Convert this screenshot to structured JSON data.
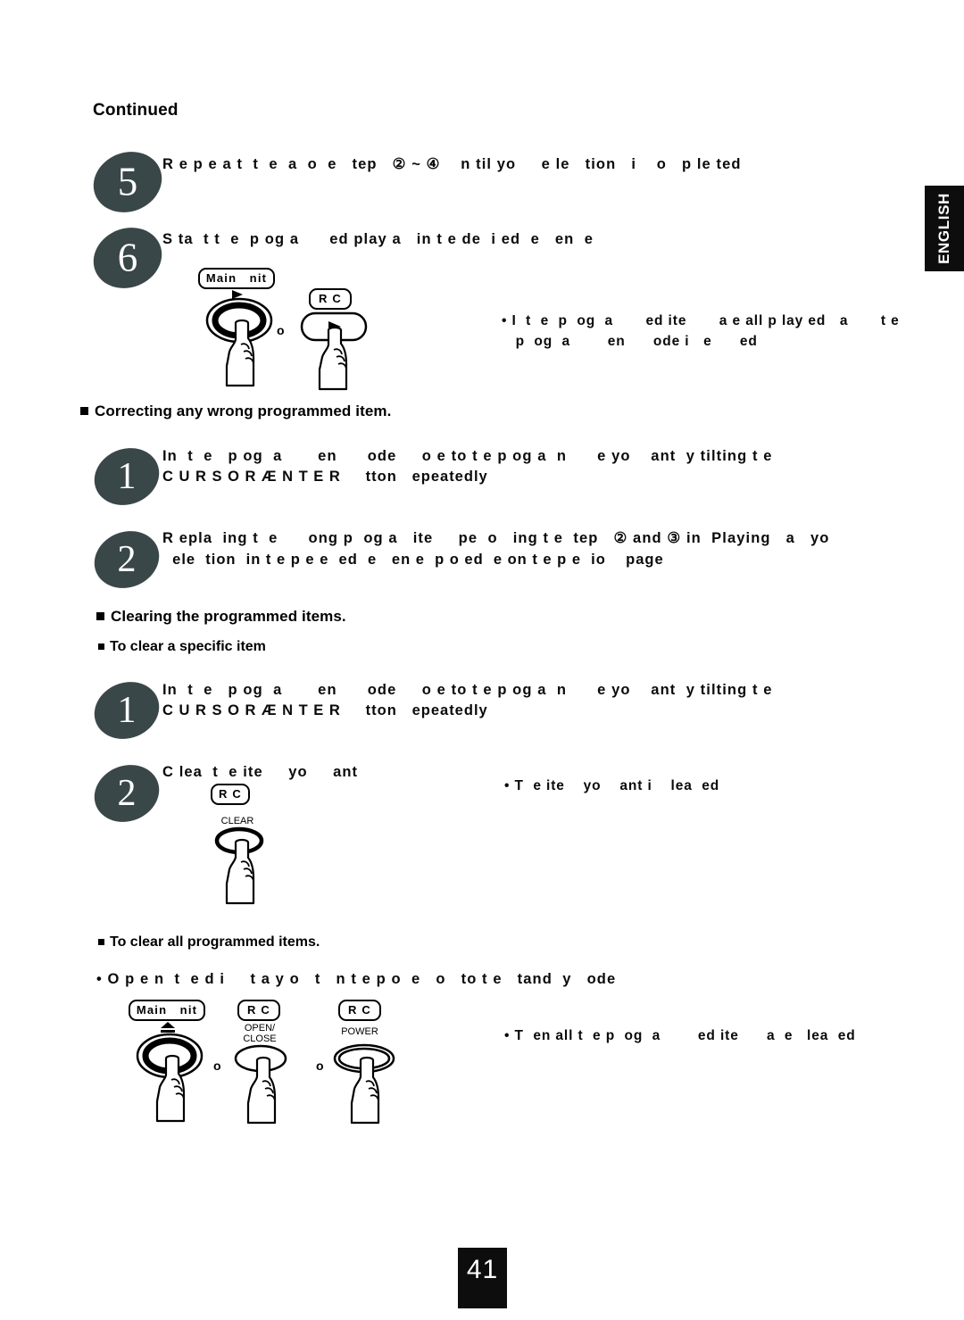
{
  "document": {
    "continued_label": "Continued",
    "side_tab_label": "ENGLISH",
    "page_number": "41"
  },
  "steps_top": [
    {
      "number": "5",
      "line1": "R e p e a t  t  e  a  o  e   tep   ② ~ ④    n til yo     e le   tion   i    o   p le ted"
    },
    {
      "number": "6",
      "line1": "S ta  t t  e  p og a      ed play a   in t e de  i ed  e   en  e"
    }
  ],
  "note_top": {
    "line1": "• I  t  e  p  og  a       ed ite       a e all p lay ed   a       t e",
    "line2": "   p  og  a        en      ode i   e      ed"
  },
  "device_top": {
    "main_unit_badge": "Main   nit",
    "rc_badge": "R C",
    "or_label": "o",
    "main_unit_icon": "play-triangle-icon",
    "rc_icon": "play-triangle-icon"
  },
  "section_correcting": {
    "heading": "Correcting any wrong programmed item.",
    "steps": [
      {
        "number": "1",
        "line1": "In  t  e   p og  a       en      ode     o e to t e p og a  n      e yo    ant  y tilting t e",
        "line2": "C U R S O R Æ N T E R     tton   epeatedly"
      },
      {
        "number": "2",
        "line1": "R epla  ing t  e      ong p  og a   ite     pe  o   ing t e  tep   ② and ③ in  Playing   a   yo",
        "line2": "  ele  tion  in t e p e e  ed  e   en e  p o ed  e on t e p e  io    page"
      }
    ]
  },
  "section_clearing": {
    "heading": "Clearing the programmed items.",
    "sub_heading_specific": "To clear a specific item",
    "steps": [
      {
        "number": "1",
        "line1": "In  t  e   p og  a       en      ode     o e to t e p og a  n      e yo    ant  y tilting t e",
        "line2": "C U R S O R Æ N T E R     tton   epeatedly"
      },
      {
        "number": "2",
        "line1": "C lea  t  e ite     yo     ant"
      }
    ],
    "clear_device": {
      "rc_badge": "R C",
      "button_caption": "CLEAR"
    },
    "note": "• T  e ite    yo    ant i    lea  ed"
  },
  "section_clear_all": {
    "sub_heading": "To clear all programmed items.",
    "instruction": "• O p e n  t  e d i     t a y o   t   n t e p o  e   o   to t e   tand  y   ode",
    "devices": {
      "main_unit_badge": "Main   nit",
      "rc_badge_1": "R C",
      "rc_badge_2": "R C",
      "main_unit_icon": "eject-icon",
      "open_close_caption": "OPEN/\nCLOSE",
      "power_caption": "POWER",
      "or_label_1": "o",
      "or_label_2": "o"
    },
    "note": "• T  en all t  e p  og  a        ed ite      a  e   lea  ed"
  }
}
